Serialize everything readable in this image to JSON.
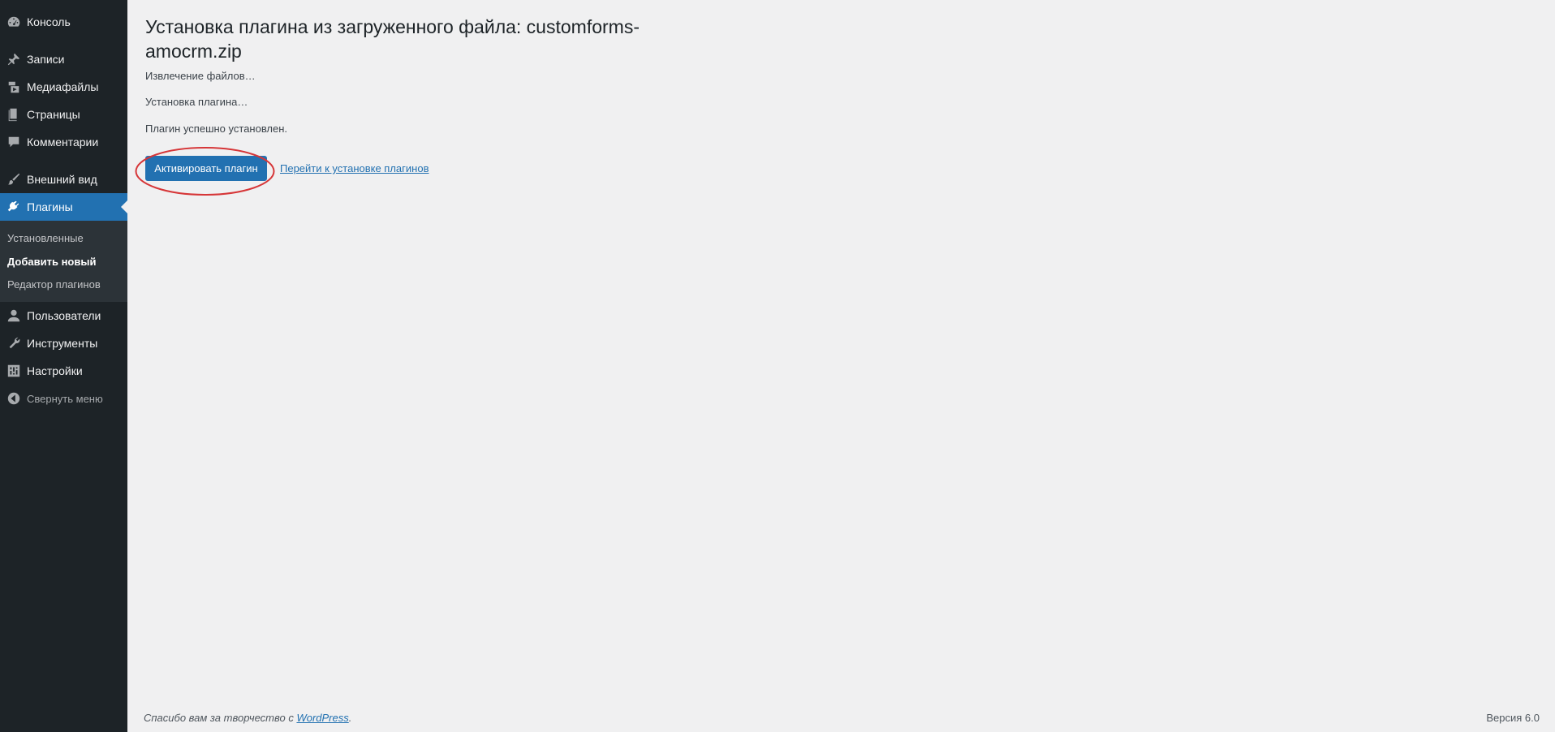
{
  "sidebar": {
    "items": [
      {
        "label": "Консоль",
        "icon": "dashboard-icon"
      },
      {
        "label": "Записи",
        "icon": "pushpin-icon"
      },
      {
        "label": "Медиафайлы",
        "icon": "media-icon"
      },
      {
        "label": "Страницы",
        "icon": "pages-icon"
      },
      {
        "label": "Комментарии",
        "icon": "comments-icon"
      },
      {
        "label": "Внешний вид",
        "icon": "paintbrush-icon"
      },
      {
        "label": "Плагины",
        "icon": "plugin-icon"
      },
      {
        "label": "Пользователи",
        "icon": "user-icon"
      },
      {
        "label": "Инструменты",
        "icon": "wrench-icon"
      },
      {
        "label": "Настройки",
        "icon": "settings-icon"
      }
    ],
    "submenu": [
      {
        "label": "Установленные"
      },
      {
        "label": "Добавить новый"
      },
      {
        "label": "Редактор плагинов"
      }
    ],
    "collapse_label": "Свернуть меню",
    "accent_color": "#2271b1",
    "background_color": "#1d2327"
  },
  "main": {
    "title": "Установка плагина из загруженного файла: customforms-amocrm.zip",
    "status": [
      "Извлечение файлов…",
      "Установка плагина…",
      "Плагин успешно установлен."
    ],
    "activate_label": "Активировать плагин",
    "installer_link": "Перейти к установке плагинов",
    "highlight_color": "#d63638"
  },
  "footer": {
    "thanks_prefix": "Спасибо вам за творчество с ",
    "thanks_link": "WordPress",
    "thanks_suffix": ".",
    "version": "Версия 6.0"
  }
}
